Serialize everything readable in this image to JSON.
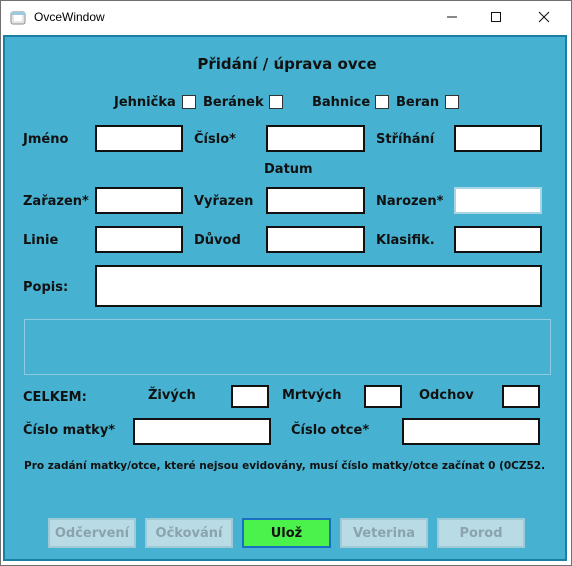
{
  "window": {
    "title": "OvceWindow"
  },
  "form": {
    "heading": "Přidání / úprava ovce",
    "checkboxes": [
      "Jehnička",
      "Beránek",
      "Bahnice",
      "Beran"
    ],
    "labels": {
      "jmeno": "Jméno",
      "cislo": "Číslo*",
      "strihani": "Stříhání",
      "datum": "Datum",
      "zarazen": "Zařazen*",
      "vyrazen": "Vyřazen",
      "narozen": "Narozen*",
      "linie": "Linie",
      "duvod": "Důvod",
      "klasifik": "Klasifik.",
      "popis": "Popis:",
      "celkem": "CELKEM:",
      "zivych": "Živých",
      "mrtvych": "Mrtvých",
      "odchov": "Odchov",
      "cislo_matky": "Číslo matky*",
      "cislo_otce": "Číslo otce*"
    },
    "note": "Pro zadání matky/otce, které nejsou evidovány, musí číslo matky/otce začínat 0 (0CZ52."
  },
  "buttons": {
    "odcerveni": "Odčervení",
    "ockovani": "Očkování",
    "uloz": "Ulož",
    "veterina": "Veterina",
    "porod": "Porod"
  },
  "colors": {
    "background": "#46b1d0",
    "save_button": "#4cf24c",
    "disabled_button": "#b9dbe6"
  }
}
